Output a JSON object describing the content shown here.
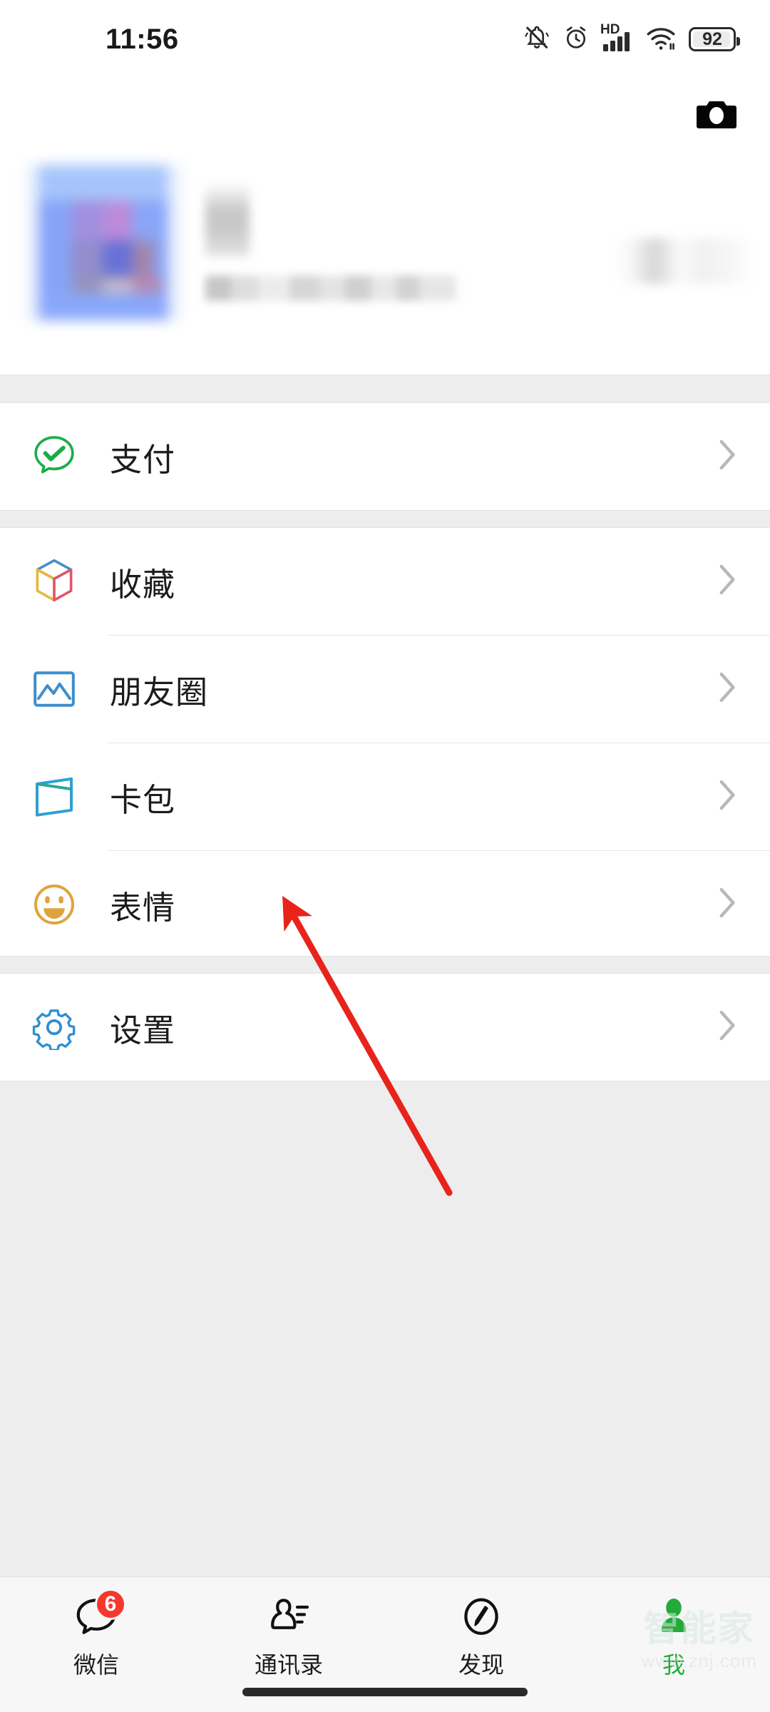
{
  "status_bar": {
    "time": "11:56",
    "battery_percent": "92",
    "network_label": "HD",
    "icons": [
      "mute-bell-icon",
      "alarm-clock-icon",
      "signal-bars-icon",
      "wifi-icon",
      "battery-icon"
    ]
  },
  "header": {
    "camera_icon": "camera-icon",
    "avatar": "blurred-avatar",
    "nickname": "",
    "wechat_id": "",
    "qr_icon": "blurred-qr-code"
  },
  "groups": [
    {
      "items": [
        {
          "label": "支付",
          "icon": "pay-icon",
          "chevron": "chevron-right-icon"
        }
      ]
    },
    {
      "items": [
        {
          "label": "收藏",
          "icon": "favorites-icon",
          "chevron": "chevron-right-icon"
        },
        {
          "label": "朋友圈",
          "icon": "moments-icon",
          "chevron": "chevron-right-icon"
        },
        {
          "label": "卡包",
          "icon": "cards-icon",
          "chevron": "chevron-right-icon"
        },
        {
          "label": "表情",
          "icon": "stickers-icon",
          "chevron": "chevron-right-icon"
        }
      ]
    },
    {
      "items": [
        {
          "label": "设置",
          "icon": "settings-gear-icon",
          "chevron": "chevron-right-icon"
        }
      ]
    }
  ],
  "tabbar": {
    "tabs": [
      {
        "label": "微信",
        "icon": "chat-bubble-icon",
        "badge": "6",
        "active": false
      },
      {
        "label": "通讯录",
        "icon": "contacts-icon",
        "badge": "",
        "active": false
      },
      {
        "label": "发现",
        "icon": "compass-icon",
        "badge": "",
        "active": false
      },
      {
        "label": "我",
        "icon": "person-icon",
        "badge": "",
        "active": true
      }
    ]
  },
  "watermark": {
    "main": "智能家",
    "sub": "www.znj.com"
  },
  "annotation": {
    "type": "arrow",
    "color": "#e8231c",
    "points_to": "表情"
  },
  "colors": {
    "accent_green": "#22ab38",
    "pay_green": "#19ad4a",
    "moments_blue": "#3f8ecb",
    "cards_blue": "#2f9fd4",
    "stickers_orange": "#e0a33c",
    "settings_blue": "#2f8fd0",
    "badge_red": "#f5372e",
    "page_bg": "#ededed",
    "card_bg": "#ffffff"
  }
}
